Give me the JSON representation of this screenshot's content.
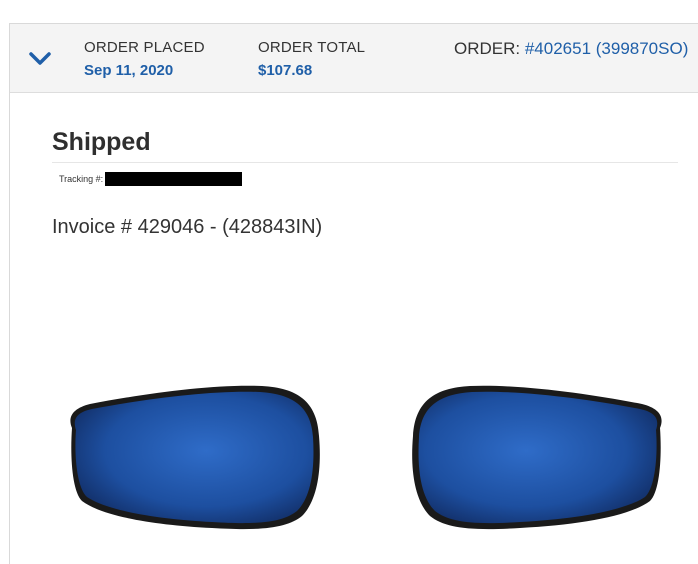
{
  "order": {
    "placed_label": "ORDER PLACED",
    "placed_value": "Sep 11, 2020",
    "total_label": "ORDER TOTAL",
    "total_value": "$107.68",
    "number_label": "ORDER: ",
    "number_value": "#402651 (399870SO)"
  },
  "shipment": {
    "status": "Shipped",
    "tracking_label": "Tracking #:",
    "invoice": "Invoice # 429046 - (428843IN)"
  },
  "colors": {
    "link": "#1f5fa8",
    "header_bg": "#f4f4f4",
    "mirror_blue": "#1d4fa0"
  },
  "icons": {
    "toggle": "chevron-down-icon"
  }
}
